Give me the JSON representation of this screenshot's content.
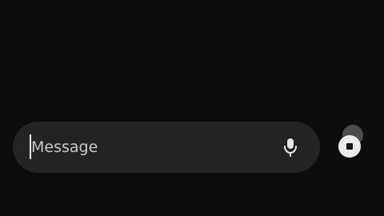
{
  "composer": {
    "placeholder": "Message",
    "value": "",
    "mic_icon": "microphone-icon"
  },
  "stop_button": {
    "icon": "stop-icon"
  },
  "colors": {
    "background": "#0d0d0d",
    "composer_background": "#232323",
    "text": "#d6d6d6",
    "stop_button": "#ebebeb"
  }
}
